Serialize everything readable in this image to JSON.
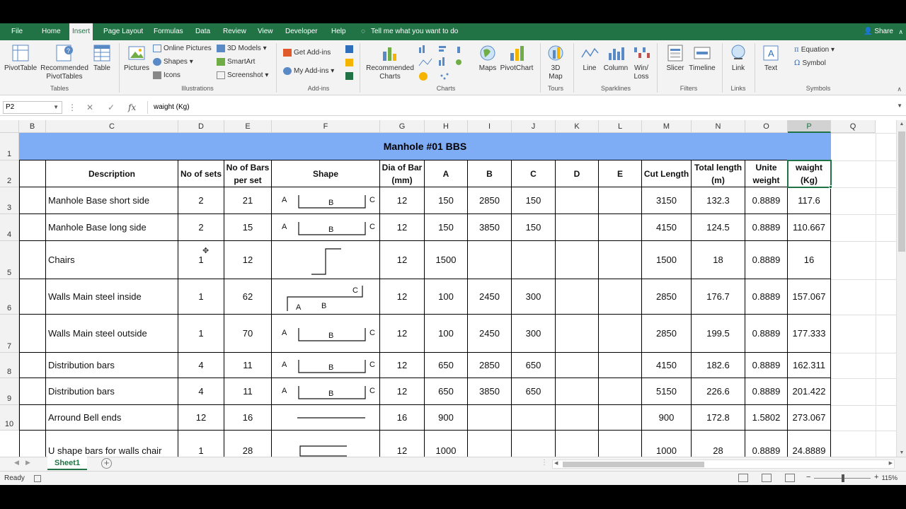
{
  "ribbon_tabs": [
    "File",
    "Home",
    "Insert",
    "Page Layout",
    "Formulas",
    "Data",
    "Review",
    "View",
    "Developer",
    "Help"
  ],
  "active_tab": "Insert",
  "tell_me": "Tell me what you want to do",
  "share": "Share",
  "ribbon": {
    "pivottable": "PivotTable",
    "recommended_pivot": "Recommended PivotTables",
    "table": "Table",
    "group_tables": "Tables",
    "pictures": "Pictures",
    "online_pictures": "Online Pictures",
    "shapes": "Shapes",
    "icons": "Icons",
    "models_3d": "3D Models",
    "smartart": "SmartArt",
    "screenshot": "Screenshot",
    "group_illustrations": "Illustrations",
    "get_addins": "Get Add-ins",
    "my_addins": "My Add-ins",
    "group_addins": "Add-ins",
    "recommended_charts": "Recommended Charts",
    "maps": "Maps",
    "pivotchart": "PivotChart",
    "group_charts": "Charts",
    "map_3d": "3D Map",
    "group_tours": "Tours",
    "line": "Line",
    "column": "Column",
    "winloss": "Win/ Loss",
    "group_sparklines": "Sparklines",
    "slicer": "Slicer",
    "timeline": "Timeline",
    "group_filters": "Filters",
    "link": "Link",
    "group_links": "Links",
    "text": "Text",
    "equation": "Equation",
    "symbol": "Symbol",
    "group_symbols": "Symbols"
  },
  "formula_bar": {
    "name_box": "P2",
    "value": "waight (Kg)"
  },
  "columns": [
    "B",
    "C",
    "D",
    "E",
    "F",
    "G",
    "H",
    "I",
    "J",
    "K",
    "L",
    "M",
    "N",
    "O",
    "P",
    "Q"
  ],
  "selected_column": "P",
  "rows": [
    "1",
    "2",
    "3",
    "4",
    "5",
    "6",
    "7",
    "8",
    "9",
    "10"
  ],
  "sheet_title": "Manhole #01 BBS",
  "headers": [
    "Description",
    "No of sets",
    "No of Bars per set",
    "Shape",
    "Dia of Bar (mm)",
    "A",
    "B",
    "C",
    "D",
    "E",
    "Cut Length",
    "Total length (m)",
    "Unite weight",
    "waight (Kg)"
  ],
  "table": [
    {
      "desc": "Manhole Base short side",
      "sets": "2",
      "bars": "21",
      "dia": "12",
      "a": "150",
      "b": "2850",
      "c": "150",
      "d": "",
      "e": "",
      "cut": "3150",
      "total": "132.3",
      "unit": "0.8889",
      "weight": "117.6"
    },
    {
      "desc": "Manhole Base  long side",
      "sets": "2",
      "bars": "15",
      "dia": "12",
      "a": "150",
      "b": "3850",
      "c": "150",
      "d": "",
      "e": "",
      "cut": "4150",
      "total": "124.5",
      "unit": "0.8889",
      "weight": "110.667"
    },
    {
      "desc": "Chairs",
      "sets": "1",
      "bars": "12",
      "dia": "12",
      "a": "1500",
      "b": "",
      "c": "",
      "d": "",
      "e": "",
      "cut": "1500",
      "total": "18",
      "unit": "0.8889",
      "weight": "16"
    },
    {
      "desc": "Walls Main steel inside",
      "sets": "1",
      "bars": "62",
      "dia": "12",
      "a": "100",
      "b": "2450",
      "c": "300",
      "d": "",
      "e": "",
      "cut": "2850",
      "total": "176.7",
      "unit": "0.8889",
      "weight": "157.067"
    },
    {
      "desc": "Walls Main steel outside",
      "sets": "1",
      "bars": "70",
      "dia": "12",
      "a": "100",
      "b": "2450",
      "c": "300",
      "d": "",
      "e": "",
      "cut": "2850",
      "total": "199.5",
      "unit": "0.8889",
      "weight": "177.333"
    },
    {
      "desc": "Distribution bars",
      "sets": "4",
      "bars": "11",
      "dia": "12",
      "a": "650",
      "b": "2850",
      "c": "650",
      "d": "",
      "e": "",
      "cut": "4150",
      "total": "182.6",
      "unit": "0.8889",
      "weight": "162.311"
    },
    {
      "desc": "Distribution bars",
      "sets": "4",
      "bars": "11",
      "dia": "12",
      "a": "650",
      "b": "3850",
      "c": "650",
      "d": "",
      "e": "",
      "cut": "5150",
      "total": "226.6",
      "unit": "0.8889",
      "weight": "201.422"
    },
    {
      "desc": "Arround Bell ends",
      "sets": "12",
      "bars": "16",
      "dia": "16",
      "a": "900",
      "b": "",
      "c": "",
      "d": "",
      "e": "",
      "cut": "900",
      "total": "172.8",
      "unit": "1.5802",
      "weight": "273.067"
    },
    {
      "desc": "U shape bars for walls chair",
      "sets": "1",
      "bars": "28",
      "dia": "12",
      "a": "1000",
      "b": "",
      "c": "",
      "d": "",
      "e": "",
      "cut": "1000",
      "total": "28",
      "unit": "0.8889",
      "weight": "24.8889"
    }
  ],
  "shape_labels": {
    "a": "A",
    "b": "B",
    "c": "C"
  },
  "sheet_tab": "Sheet1",
  "status": "Ready",
  "zoom": "115%"
}
